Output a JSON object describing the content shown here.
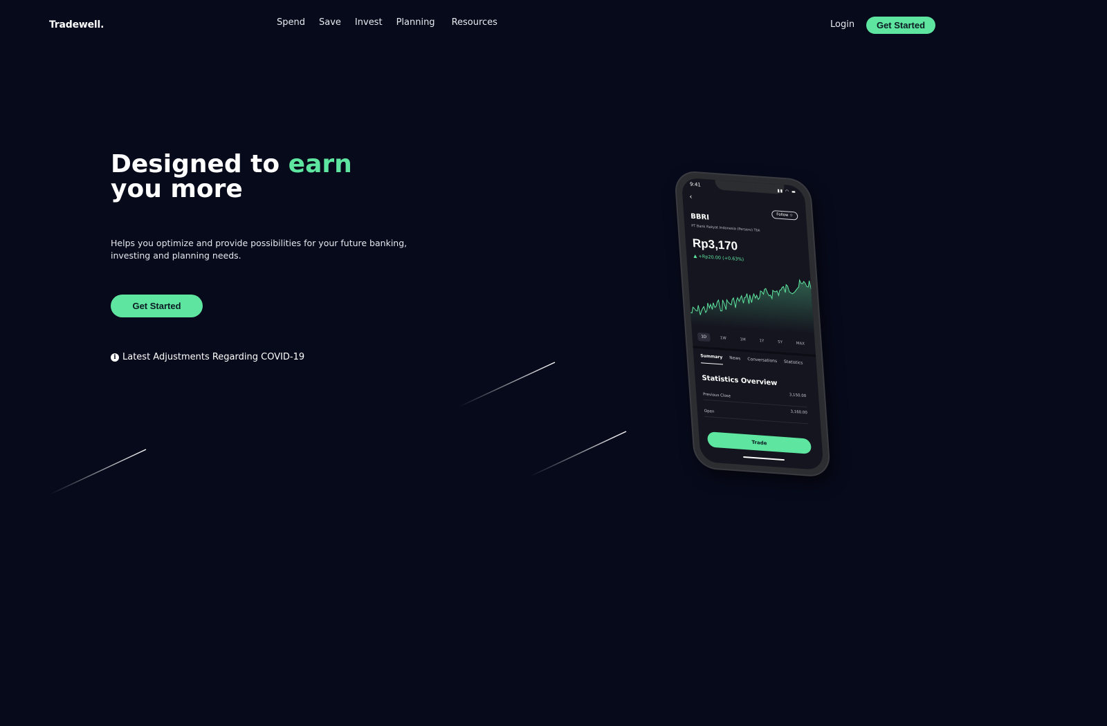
{
  "header": {
    "logo": "Tradewell.",
    "nav": [
      "Spend",
      "Save",
      "Invest",
      "Planning",
      "Resources"
    ],
    "login": "Login",
    "cta": "Get Started"
  },
  "hero": {
    "title_prefix": "Designed to ",
    "title_accent": "earn",
    "title_line2": "you more",
    "description": "Helps you optimize and provide possibilities for your future banking, investing and planning needs.",
    "cta": "Get Started",
    "notice": "Latest Adjustments Regarding COVID-19"
  },
  "phone": {
    "time": "9:41",
    "follow": "Follow ☆",
    "ticker": "BBRI",
    "company": "PT Bank Rakyat Indonesia (Persero) Tbk",
    "price": "Rp3,170",
    "change": "+Rp20.00 (+0.63%)",
    "ranges": [
      "1D",
      "1W",
      "1M",
      "1Y",
      "5Y",
      "MAX"
    ],
    "active_range": "1D",
    "tabs": [
      "Summary",
      "News",
      "Conversations",
      "Statistics"
    ],
    "stats_title": "Statistics Overview",
    "stats": [
      {
        "label": "Previous Close",
        "value": "3,150.00"
      },
      {
        "label": "Open",
        "value": "3,160.00"
      }
    ],
    "trade": "Trade"
  },
  "colors": {
    "background": "#070a1b",
    "accent": "#5ee6a0"
  }
}
